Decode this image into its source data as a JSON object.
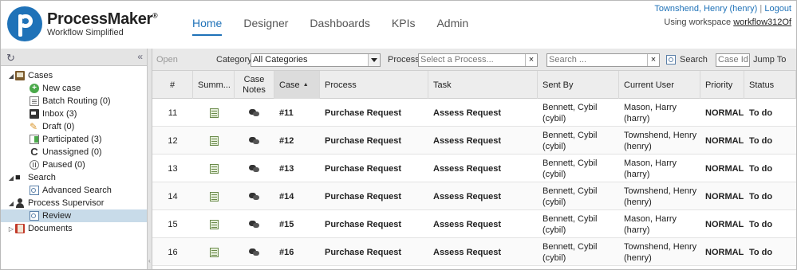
{
  "header": {
    "brand": "ProcessMaker",
    "brand_mark": "®",
    "tagline": "Workflow Simplified",
    "nav": [
      "Home",
      "Designer",
      "Dashboards",
      "KPIs",
      "Admin"
    ],
    "active_nav": "Home",
    "user": "Townshend, Henry (henry)",
    "separator": "|",
    "logout": "Logout",
    "workspace_prefix": "Using workspace",
    "workspace": "workflow312Of"
  },
  "sidebar": {
    "refresh_icon": "refresh-icon",
    "collapse_icon": "double-chevron-left-icon",
    "tree": {
      "cases": "Cases",
      "new_case": "New case",
      "batch_routing": "Batch Routing (0)",
      "inbox": "Inbox (3)",
      "draft": "Draft (0)",
      "participated": "Participated (3)",
      "unassigned": "Unassigned (0)",
      "paused": "Paused (0)",
      "search": "Search",
      "advanced_search": "Advanced Search",
      "process_supervisor": "Process Supervisor",
      "review": "Review",
      "documents": "Documents"
    }
  },
  "toolbar": {
    "open": "Open",
    "category_label": "Category",
    "category_value": "All Categories",
    "process_label": "Process",
    "process_placeholder": "Select a Process...",
    "search_placeholder": "Search ...",
    "clear": "×",
    "search_button": "Search",
    "case_id_placeholder": "Case Id",
    "jump_to": "Jump To"
  },
  "grid": {
    "columns": [
      "#",
      "Summ...",
      "Case Notes",
      "Case ▲",
      "Process",
      "Task",
      "Sent By",
      "Current User",
      "Priority",
      "Status"
    ],
    "col_num": "#",
    "col_summary": "Summ...",
    "col_notes": "Case\nNotes",
    "col_case": "Case",
    "col_process": "Process",
    "col_task": "Task",
    "col_sentby": "Sent By",
    "col_current": "Current User",
    "col_priority": "Priority",
    "col_status": "Status",
    "rows": [
      {
        "num": "11",
        "case": "#11",
        "process": "Purchase Request",
        "task": "Assess Request",
        "sent_by": "Bennett, Cybil (cybil)",
        "current_1": "Mason, Harry",
        "current_2": "(harry)",
        "priority": "NORMAL",
        "status": "To do"
      },
      {
        "num": "12",
        "case": "#12",
        "process": "Purchase Request",
        "task": "Assess Request",
        "sent_by": "Bennett, Cybil (cybil)",
        "current_1": "Townshend, Henry",
        "current_2": "(henry)",
        "priority": "NORMAL",
        "status": "To do"
      },
      {
        "num": "13",
        "case": "#13",
        "process": "Purchase Request",
        "task": "Assess Request",
        "sent_by": "Bennett, Cybil (cybil)",
        "current_1": "Mason, Harry",
        "current_2": "(harry)",
        "priority": "NORMAL",
        "status": "To do"
      },
      {
        "num": "14",
        "case": "#14",
        "process": "Purchase Request",
        "task": "Assess Request",
        "sent_by": "Bennett, Cybil (cybil)",
        "current_1": "Townshend, Henry",
        "current_2": "(henry)",
        "priority": "NORMAL",
        "status": "To do"
      },
      {
        "num": "15",
        "case": "#15",
        "process": "Purchase Request",
        "task": "Assess Request",
        "sent_by": "Bennett, Cybil (cybil)",
        "current_1": "Mason, Harry",
        "current_2": "(harry)",
        "priority": "NORMAL",
        "status": "To do"
      },
      {
        "num": "16",
        "case": "#16",
        "process": "Purchase Request",
        "task": "Assess Request",
        "sent_by": "Bennett, Cybil (cybil)",
        "current_1": "Townshend, Henry",
        "current_2": "(henry)",
        "priority": "NORMAL",
        "status": "To do"
      }
    ]
  },
  "colors": {
    "accent": "#1f72b8",
    "selection": "#c8dbe9",
    "toolbar": "#e9e9e9"
  }
}
